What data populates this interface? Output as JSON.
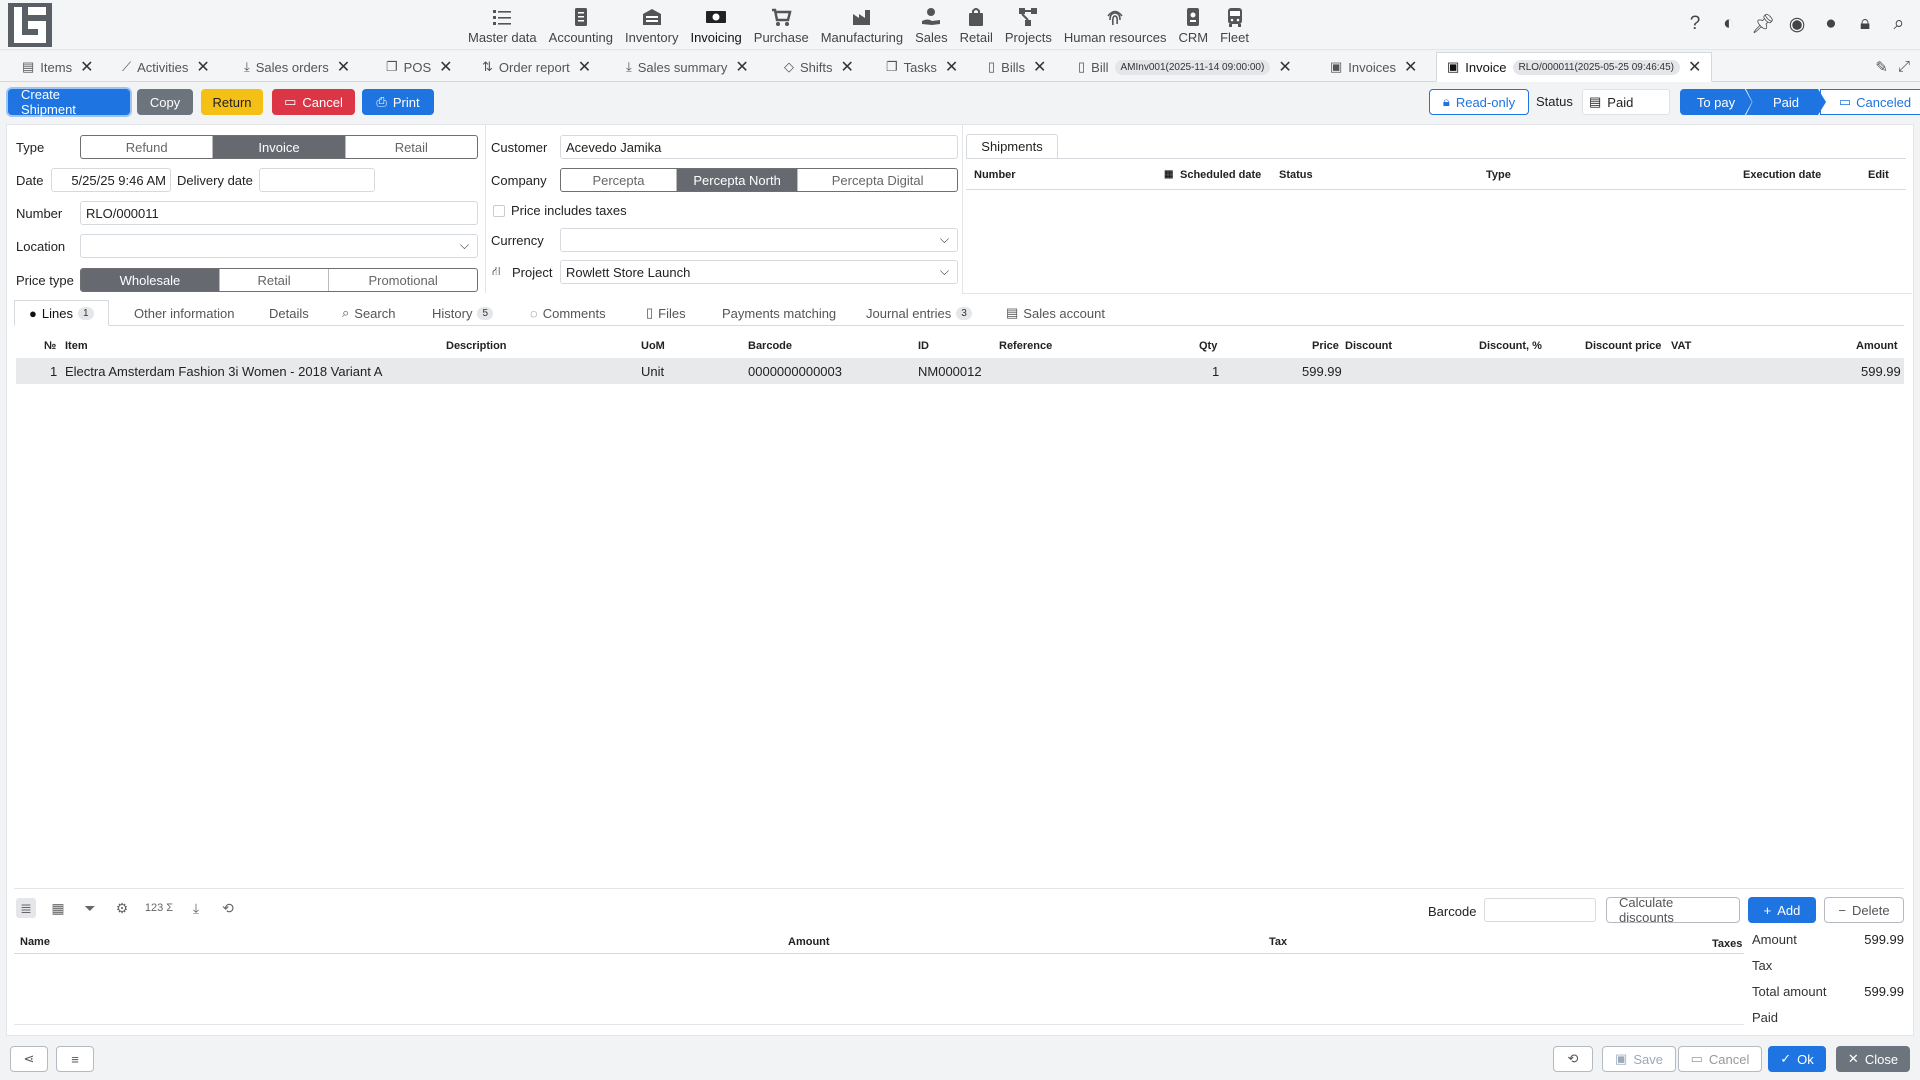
{
  "nav": {
    "items": [
      {
        "label": "Master data",
        "icon": "list-icon"
      },
      {
        "label": "Accounting",
        "icon": "ledger-icon"
      },
      {
        "label": "Inventory",
        "icon": "warehouse-icon"
      },
      {
        "label": "Invoicing",
        "icon": "money-icon"
      },
      {
        "label": "Purchase",
        "icon": "cart-icon"
      },
      {
        "label": "Manufacturing",
        "icon": "factory-icon"
      },
      {
        "label": "Sales",
        "icon": "hand-money-icon"
      },
      {
        "label": "Retail",
        "icon": "bag-icon"
      },
      {
        "label": "Projects",
        "icon": "diagram-icon"
      },
      {
        "label": "Human resources",
        "icon": "fingerprint-icon"
      },
      {
        "label": "CRM",
        "icon": "id-card-icon"
      },
      {
        "label": "Fleet",
        "icon": "bus-icon"
      }
    ],
    "active": "Invoicing"
  },
  "tabs": [
    {
      "label": "Items"
    },
    {
      "label": "Activities"
    },
    {
      "label": "Sales orders"
    },
    {
      "label": "POS"
    },
    {
      "label": "Order report"
    },
    {
      "label": "Sales summary"
    },
    {
      "label": "Shifts"
    },
    {
      "label": "Tasks"
    },
    {
      "label": "Bills"
    },
    {
      "label": "Bill",
      "tag": "AMInv001(2025-11-14 09:00:00)"
    },
    {
      "label": "Invoices"
    },
    {
      "label": "Invoice",
      "tag": "RLO/000011(2025-05-25 09:46:45)"
    }
  ],
  "toolbar": {
    "create_shipment": "Create Shipment",
    "copy": "Copy",
    "return": "Return",
    "cancel": "Cancel",
    "print": "Print",
    "read_only": "Read-only",
    "status_label": "Status",
    "status_value": "Paid",
    "steps": [
      "To pay",
      "Paid",
      "Canceled"
    ]
  },
  "form": {
    "type_label": "Type",
    "type_options": [
      "Refund",
      "Invoice",
      "Retail"
    ],
    "type_selected": "Invoice",
    "date_label": "Date",
    "date_value": "5/25/25 9:46 AM",
    "delivery_label": "Delivery date",
    "delivery_value": "",
    "number_label": "Number",
    "number_value": "RLO/000011",
    "location_label": "Location",
    "location_value": "",
    "price_type_label": "Price type",
    "price_type_options": [
      "Wholesale",
      "Retail",
      "Promotional"
    ],
    "price_type_selected": "Wholesale",
    "customer_label": "Customer",
    "customer_value": "Acevedo Jamika",
    "company_label": "Company",
    "company_options": [
      "Percepta",
      "Percepta North",
      "Percepta Digital"
    ],
    "company_selected": "Percepta North",
    "price_includes_taxes": "Price includes taxes",
    "currency_label": "Currency",
    "currency_value": "",
    "project_label": "Project",
    "project_value": "Rowlett Store Launch"
  },
  "shipments": {
    "tab": "Shipments",
    "columns": [
      "Number",
      "Scheduled date",
      "Status",
      "Type",
      "Execution date",
      "Edit"
    ]
  },
  "subtabs": [
    {
      "label": "Lines",
      "count": "1"
    },
    {
      "label": "Other information"
    },
    {
      "label": "Details"
    },
    {
      "label": "Search"
    },
    {
      "label": "History",
      "count": "5"
    },
    {
      "label": "Comments"
    },
    {
      "label": "Files"
    },
    {
      "label": "Payments matching"
    },
    {
      "label": "Journal entries",
      "count": "3"
    },
    {
      "label": "Sales account"
    }
  ],
  "lines": {
    "columns": [
      "№",
      "Item",
      "Description",
      "UoM",
      "Barcode",
      "ID",
      "Reference",
      "Qty",
      "Price",
      "Discount",
      "Discount, %",
      "Discount price",
      "VAT",
      "Amount"
    ],
    "rows": [
      {
        "no": "1",
        "item": "Electra Amsterdam Fashion 3i Women - 2018 Variant A",
        "description": "",
        "uom": "Unit",
        "barcode": "0000000000003",
        "id": "NM000012",
        "reference": "",
        "qty": "1",
        "price": "599.99",
        "discount": "",
        "discount_pct": "",
        "discount_price": "",
        "vat": "",
        "amount": "599.99"
      }
    ]
  },
  "bottom": {
    "barcode_label": "Barcode",
    "calculate_discounts": "Calculate discounts",
    "add": "Add",
    "delete": "Delete",
    "tax_columns": [
      "Name",
      "Amount",
      "Tax",
      "Taxes"
    ],
    "totals": {
      "amount_label": "Amount",
      "amount": "599.99",
      "tax_label": "Tax",
      "tax": "",
      "total_label": "Total amount",
      "total": "599.99",
      "paid_label": "Paid",
      "paid": ""
    }
  },
  "footer": {
    "save": "Save",
    "cancel": "Cancel",
    "ok": "Ok",
    "close": "Close"
  },
  "colors": {
    "primary": "#1e74e0",
    "danger": "#dc3545",
    "warning": "#f5c016",
    "secondary": "#6c757d"
  }
}
